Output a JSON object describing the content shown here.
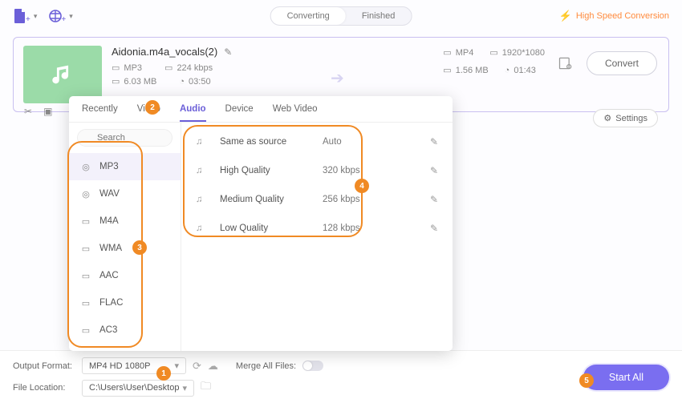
{
  "header": {
    "tab_converting": "Converting",
    "tab_finished": "Finished",
    "high_speed": "High Speed Conversion"
  },
  "file": {
    "name": "Aidonia.m4a_vocals(2)",
    "src_format": "MP3",
    "src_bitrate": "224 kbps",
    "src_size": "6.03 MB",
    "src_duration": "03:50",
    "dst_format": "MP4",
    "dst_res": "1920*1080",
    "dst_size": "1.56 MB",
    "dst_time": "01:43",
    "convert_label": "Convert",
    "settings_label": "Settings"
  },
  "popup": {
    "tabs": {
      "recently": "Recently",
      "video": "Video",
      "audio": "Audio",
      "device": "Device",
      "webvideo": "Web Video"
    },
    "search_placeholder": "Search",
    "formats": [
      "MP3",
      "WAV",
      "M4A",
      "WMA",
      "AAC",
      "FLAC",
      "AC3"
    ],
    "qualities": [
      {
        "label": "Same as source",
        "value": "Auto"
      },
      {
        "label": "High Quality",
        "value": "320 kbps"
      },
      {
        "label": "Medium Quality",
        "value": "256 kbps"
      },
      {
        "label": "Low Quality",
        "value": "128 kbps"
      }
    ]
  },
  "bottom": {
    "output_format_label": "Output Format:",
    "output_format_value": "MP4 HD 1080P",
    "file_location_label": "File Location:",
    "file_location_value": "C:\\Users\\User\\Desktop",
    "merge_label": "Merge All Files:",
    "start_all": "Start All"
  },
  "badges": {
    "b1": "1",
    "b2": "2",
    "b3": "3",
    "b4": "4",
    "b5": "5"
  }
}
